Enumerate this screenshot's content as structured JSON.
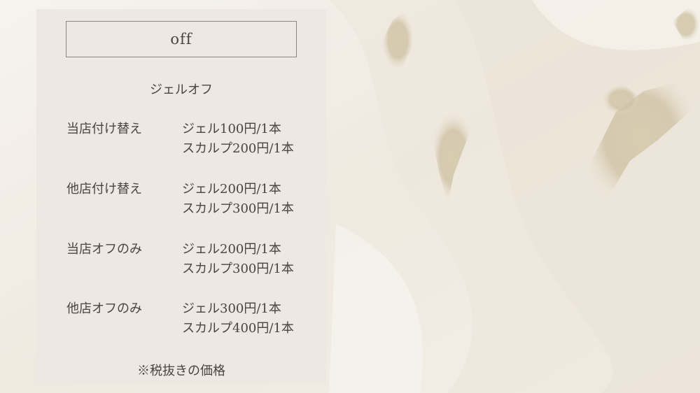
{
  "title": "off",
  "subtitle": "ジェルオフ",
  "rows": [
    {
      "label": "当店付け替え",
      "gel": "ジェル100円/1本",
      "sculp": "スカルプ200円/1本"
    },
    {
      "label": "他店付け替え",
      "gel": "ジェル200円/1本",
      "sculp": "スカルプ300円/1本"
    },
    {
      "label": "当店オフのみ",
      "gel": "ジェル200円/1本",
      "sculp": "スカルプ300円/1本"
    },
    {
      "label": "他店オフのみ",
      "gel": "ジェル300円/1本",
      "sculp": "スカルプ400円/1本"
    }
  ],
  "footnote": "※税抜きの価格",
  "colors": {
    "panel": "#ede8e2",
    "text": "#4a4440",
    "background": "#f4f0ea",
    "gold_accent": "#cfc3a6"
  }
}
